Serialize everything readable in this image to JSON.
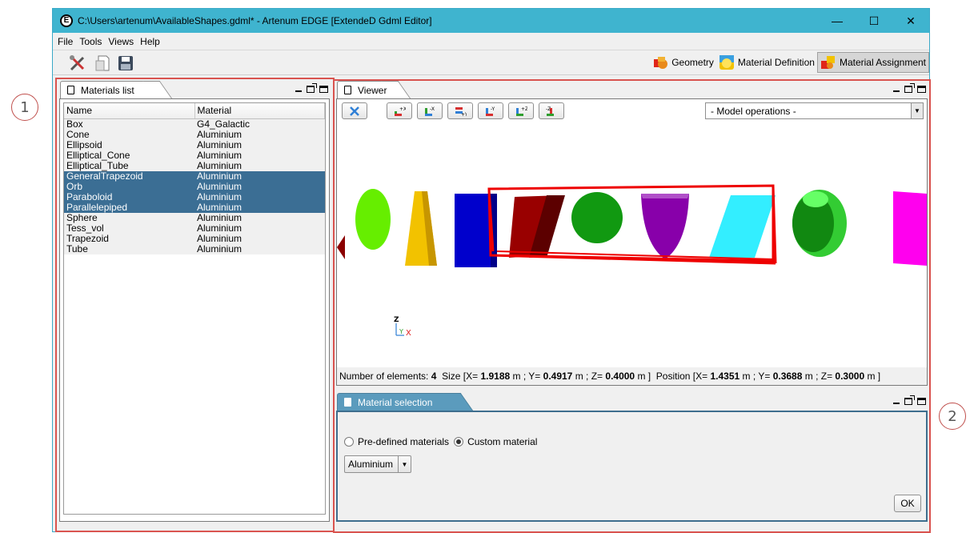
{
  "window": {
    "title": "C:\\Users\\artenum\\AvailableShapes.gdml* - Artenum EDGE [ExtendeD Gdml Editor]",
    "app_icon_letter": "E",
    "minimize_glyph": "—",
    "maximize_glyph": "☐",
    "close_glyph": "✕"
  },
  "menu": [
    "File",
    "Tools",
    "Views",
    "Help"
  ],
  "perspectives": {
    "geometry": "Geometry",
    "material_definition": "Material Definition",
    "material_assignment": "Material Assignment"
  },
  "callouts": [
    "1",
    "2"
  ],
  "materials_panel": {
    "tab": "Materials list",
    "columns": [
      "Name",
      "Material"
    ],
    "rows": [
      {
        "name": "Box",
        "material": "G4_Galactic",
        "selected": false
      },
      {
        "name": "Cone",
        "material": "Aluminium",
        "selected": false
      },
      {
        "name": "Ellipsoid",
        "material": "Aluminium",
        "selected": false
      },
      {
        "name": "Elliptical_Cone",
        "material": "Aluminium",
        "selected": false
      },
      {
        "name": "Elliptical_Tube",
        "material": "Aluminium",
        "selected": false
      },
      {
        "name": "GeneralTrapezoid",
        "material": "Aluminium",
        "selected": true
      },
      {
        "name": "Orb",
        "material": "Aluminium",
        "selected": true
      },
      {
        "name": "Paraboloid",
        "material": "Aluminium",
        "selected": true
      },
      {
        "name": "Parallelepiped",
        "material": "Aluminium",
        "selected": true
      },
      {
        "name": "Sphere",
        "material": "Aluminium",
        "selected": false
      },
      {
        "name": "Tess_vol",
        "material": "Aluminium",
        "selected": false
      },
      {
        "name": "Trapezoid",
        "material": "Aluminium",
        "selected": false
      },
      {
        "name": "Tube",
        "material": "Aluminium",
        "selected": false
      }
    ]
  },
  "viewer": {
    "tab": "Viewer",
    "model_operations": "- Model operations -",
    "view_buttons": [
      "+X",
      "-X",
      "+Y",
      "-Y",
      "+Z",
      "-Z"
    ],
    "axis_labels": {
      "z": "Z",
      "y": "Y",
      "x": "X"
    },
    "status": {
      "count_label": "Number of elements:",
      "count": "4",
      "size_label": "Size [X=",
      "size_x": "1.9188",
      "size_y_label": "m ; Y=",
      "size_y": "0.4917",
      "size_z_label": "m ; Z=",
      "size_z": "0.4000",
      "size_end": "m ]",
      "pos_label": "Position [X=",
      "pos_x": "1.4351",
      "pos_y_label": "m ; Y=",
      "pos_y": "0.3688",
      "pos_z_label": "m ; Z=",
      "pos_z": "0.3000",
      "pos_end": "m ]"
    },
    "shape_colors": {
      "green_ellipsoid": "#66ee00",
      "yellow_cone": "#f2c200",
      "blue_box": "#0000cc",
      "trapezoid": "#990000",
      "sphere": "#119911",
      "paraboloid": "#8800aa",
      "parallelepiped": "#33eeff",
      "tube": "#33cc33",
      "magenta": "#ff00ee",
      "selection_box": "#ee0000"
    }
  },
  "material_selection": {
    "tab": "Material selection",
    "predefined_label": "Pre-defined materials",
    "custom_label": "Custom material",
    "selected_mode": "custom",
    "material_value": "Aluminium",
    "ok_label": "OK"
  }
}
